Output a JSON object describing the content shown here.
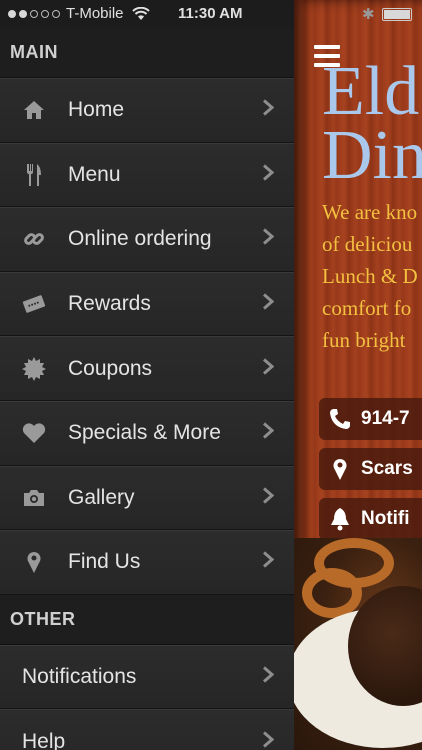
{
  "status_bar": {
    "carrier": "T-Mobile",
    "time": "11:30 AM",
    "bluetooth": "✱",
    "signal_dots_filled": 2,
    "signal_dots_total": 5
  },
  "menu": {
    "main_header": "MAIN",
    "main_items": [
      {
        "label": "Home",
        "icon": "home-icon"
      },
      {
        "label": "Menu",
        "icon": "fork-knife-icon"
      },
      {
        "label": "Online ordering",
        "icon": "link-icon"
      },
      {
        "label": "Rewards",
        "icon": "ticket-icon"
      },
      {
        "label": "Coupons",
        "icon": "badge-icon"
      },
      {
        "label": "Specials & More",
        "icon": "heart-icon"
      },
      {
        "label": "Gallery",
        "icon": "camera-icon"
      },
      {
        "label": "Find Us",
        "icon": "location-pin-icon"
      }
    ],
    "other_header": "OTHER",
    "other_items": [
      {
        "label": "Notifications"
      },
      {
        "label": "Help"
      }
    ]
  },
  "panel": {
    "title_line1": "Eld",
    "title_line2": "Din",
    "description_lines": [
      "We are kno",
      "of deliciou",
      "Lunch & D",
      "comfort fo",
      "fun bright"
    ],
    "buttons": [
      {
        "label": "914-7",
        "icon": "phone-icon"
      },
      {
        "label": "Scars",
        "icon": "location-pin-icon"
      },
      {
        "label": "Notifi",
        "icon": "bell-icon"
      }
    ]
  },
  "colors": {
    "menu_bg": "#232323",
    "menu_text": "#e4e4e4",
    "panel_wood": "#9b3a1c",
    "title_blue": "#a9c8ec",
    "desc_yellow": "#f3c040"
  }
}
